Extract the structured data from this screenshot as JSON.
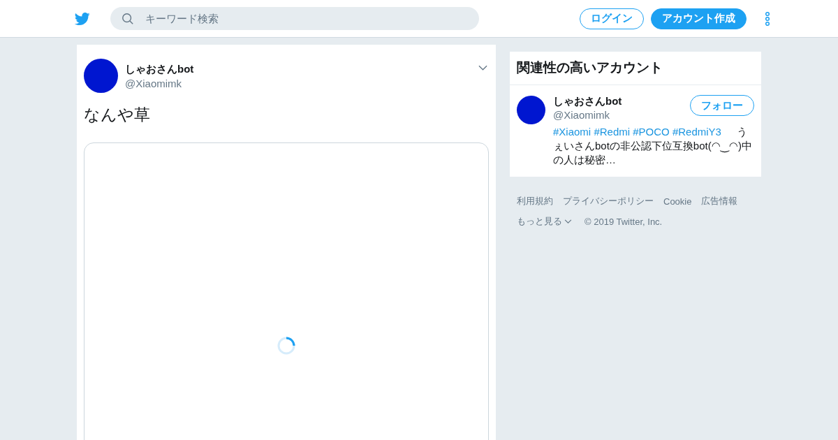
{
  "header": {
    "search": {
      "placeholder": "キーワード検索"
    },
    "login": "ログイン",
    "signup": "アカウント作成"
  },
  "tweet": {
    "name": "しゃおさんbot",
    "handle": "@Xiaomimk",
    "text": "なんや草",
    "media": {
      "loading": true
    }
  },
  "related": {
    "title": "関連性の高いアカウント",
    "accounts": [
      {
        "name": "しゃおさんbot",
        "handle": "@Xiaomimk",
        "follow": "フォロー",
        "hashtags": [
          "#Xiaomi",
          "#Redmi",
          "#POCO",
          "#RedmiY3"
        ],
        "bio": "うぇいさんbotの非公認下位互換bot(◠‿◠)中の人は秘密…"
      }
    ]
  },
  "footer": {
    "links": [
      "利用規約",
      "プライバシーポリシー",
      "Cookie",
      "広告情報"
    ],
    "more": "もっと見る",
    "copyright": "© 2019 Twitter, Inc."
  }
}
